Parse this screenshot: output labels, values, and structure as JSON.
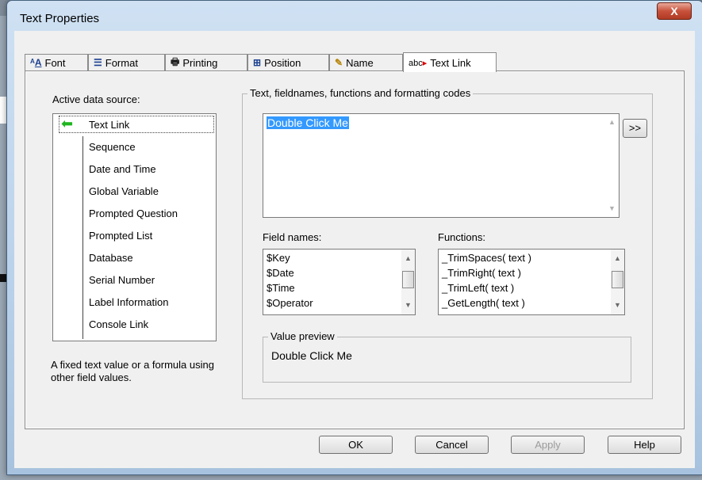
{
  "window": {
    "title": "Text Properties",
    "close_symbol": "X"
  },
  "tabs": [
    {
      "label": "Font",
      "icon": "font-icon"
    },
    {
      "label": "Format",
      "icon": "format-icon"
    },
    {
      "label": "Printing",
      "icon": "printer-icon"
    },
    {
      "label": "Position",
      "icon": "position-icon"
    },
    {
      "label": "Name",
      "icon": "name-icon"
    },
    {
      "label": "Text Link",
      "icon": "text-link-icon",
      "active": true
    }
  ],
  "data_source": {
    "label": "Active data source:",
    "items": [
      "Text Link",
      "Sequence",
      "Date and Time",
      "Global Variable",
      "Prompted Question",
      "Prompted List",
      "Database",
      "Serial Number",
      "Label Information",
      "Console Link"
    ],
    "selected": "Text Link",
    "description": "A fixed text value or a formula using other field values."
  },
  "codes_group": {
    "title": "Text, fieldnames, functions and formatting codes",
    "value": "Double Click Me",
    "insert_button": ">>"
  },
  "field_names": {
    "label": "Field names:",
    "items": [
      "$Key",
      "$Date",
      "$Time",
      "$Operator"
    ]
  },
  "functions": {
    "label": "Functions:",
    "items": [
      "_TrimSpaces( text )",
      "_TrimRight( text )",
      "_TrimLeft( text )",
      "_GetLength( text )"
    ]
  },
  "preview": {
    "title": "Value preview",
    "value": "Double Click Me"
  },
  "buttons": {
    "ok": "OK",
    "cancel": "Cancel",
    "apply": "Apply",
    "help": "Help"
  }
}
